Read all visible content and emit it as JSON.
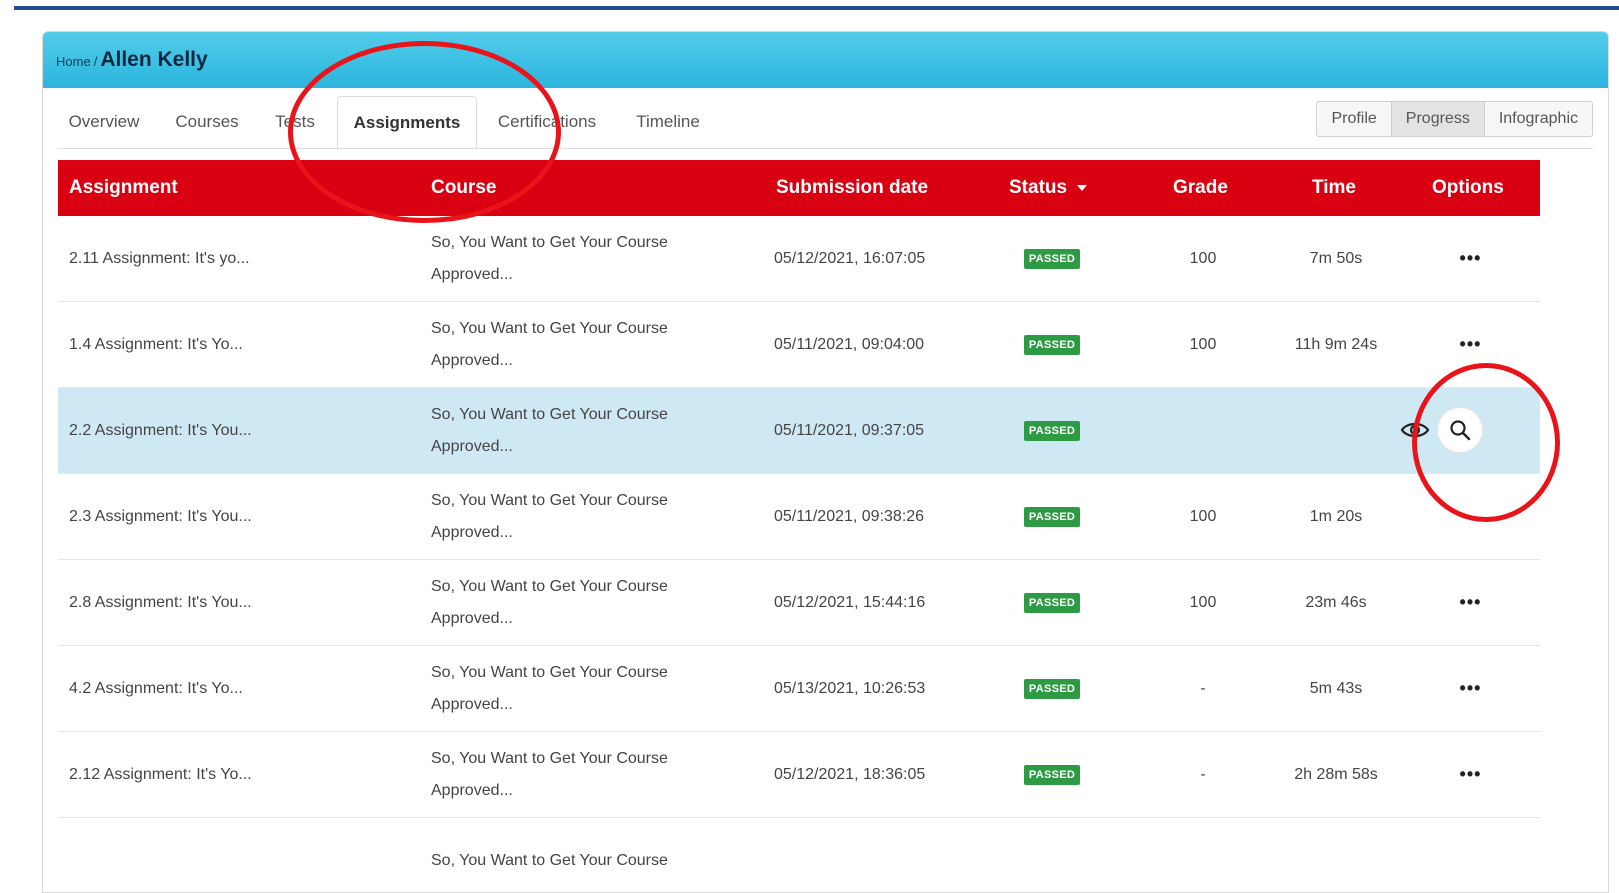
{
  "breadcrumb": {
    "home": "Home",
    "separator": "/",
    "current": "Allen Kelly"
  },
  "tabs": [
    {
      "label": "Overview"
    },
    {
      "label": "Courses"
    },
    {
      "label": "Tests"
    },
    {
      "label": "Assignments",
      "active": true
    },
    {
      "label": "Certifications"
    },
    {
      "label": "Timeline"
    }
  ],
  "view_toggle": [
    {
      "label": "Profile"
    },
    {
      "label": "Progress",
      "active": true
    },
    {
      "label": "Infographic"
    }
  ],
  "table": {
    "columns": {
      "assignment": "Assignment",
      "course": "Course",
      "submission_date": "Submission date",
      "status": "Status",
      "grade": "Grade",
      "time": "Time",
      "options": "Options"
    },
    "rows": [
      {
        "assignment": "2.11 Assignment: It's yo...",
        "course_line1": "So, You Want to Get Your Course",
        "course_line2": "Approved...",
        "date": "05/12/2021, 16:07:05",
        "status": "PASSED",
        "grade": "100",
        "time": "7m 50s",
        "options": "•••"
      },
      {
        "assignment": "1.4 Assignment: It's Yo...",
        "course_line1": "So, You Want to Get Your Course",
        "course_line2": "Approved...",
        "date": "05/11/2021, 09:04:00",
        "status": "PASSED",
        "grade": "100",
        "time": "11h 9m 24s",
        "options": "•••"
      },
      {
        "assignment": "2.2 Assignment: It's You...",
        "course_line1": "So, You Want to Get Your Course",
        "course_line2": "Approved...",
        "date": "05/11/2021, 09:37:05",
        "status": "PASSED",
        "grade": "",
        "time": "",
        "options": "",
        "highlighted": true
      },
      {
        "assignment": "2.3 Assignment: It's You...",
        "course_line1": "So, You Want to Get Your Course",
        "course_line2": "Approved...",
        "date": "05/11/2021, 09:38:26",
        "status": "PASSED",
        "grade": "100",
        "time": "1m 20s",
        "options": ""
      },
      {
        "assignment": "2.8 Assignment: It's You...",
        "course_line1": "So, You Want to Get Your Course",
        "course_line2": "Approved...",
        "date": "05/12/2021, 15:44:16",
        "status": "PASSED",
        "grade": "100",
        "time": "23m 46s",
        "options": "•••"
      },
      {
        "assignment": "4.2 Assignment: It's Yo...",
        "course_line1": "So, You Want to Get Your Course",
        "course_line2": "Approved...",
        "date": "05/13/2021, 10:26:53",
        "status": "PASSED",
        "grade": "-",
        "time": "5m 43s",
        "options": "•••"
      },
      {
        "assignment": "2.12 Assignment: It's Yo...",
        "course_line1": "So, You Want to Get Your Course",
        "course_line2": "Approved...",
        "date": "05/12/2021, 18:36:05",
        "status": "PASSED",
        "grade": "-",
        "time": "2h 28m 58s",
        "options": "•••"
      },
      {
        "assignment": "",
        "course_line1": "So, You Want to Get Your Course",
        "course_line2": "",
        "date": "",
        "status": "",
        "grade": "",
        "time": "",
        "options": ""
      }
    ]
  },
  "row_actions": {
    "preview_icon": "eye-icon",
    "search_icon": "search-icon"
  },
  "colors": {
    "header_gradient_top": "#52cdea",
    "header_gradient_bottom": "#2bb5dd",
    "table_header": "#d90012",
    "passed_badge": "#2e9a44",
    "highlight_row": "#cfe9f4",
    "annotation_ring": "#e8141a",
    "top_strip": "#1f4f8f"
  }
}
